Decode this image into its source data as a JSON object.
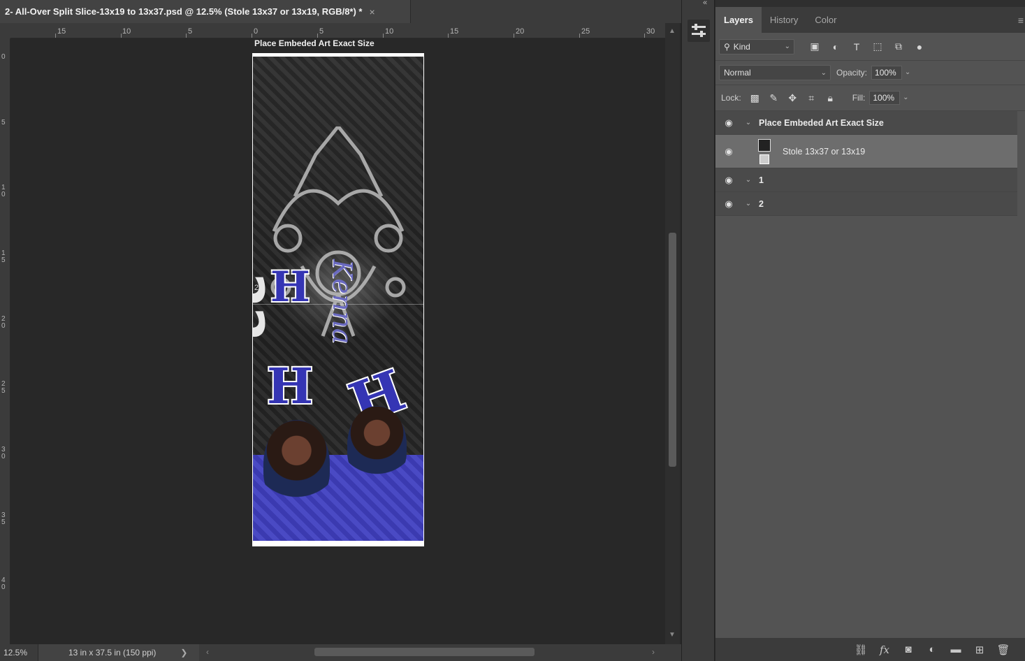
{
  "document": {
    "tab_title": "2- All-Over Split  Slice-13x19 to 13x37.psd @ 12.5% (Stole 13x37 or 13x19, RGB/8*) *",
    "close_glyph": "×"
  },
  "ruler": {
    "top_labels": [
      "15",
      "10",
      "5",
      "0",
      "5",
      "10",
      "15",
      "20",
      "25",
      "30"
    ],
    "left_labels": [
      "0",
      "5",
      "1\n0",
      "1\n5",
      "2\n0",
      "2\n5",
      "3\n0",
      "3\n5",
      "4\n0"
    ]
  },
  "canvas": {
    "caption": "Place Embeded Art Exact Size",
    "slice_marker": "2",
    "art_text_22": "22",
    "art_text_script": "Kenna"
  },
  "status": {
    "zoom": "12.5%",
    "doc_info": "13 in x 37.5 in (150 ppi)",
    "doc_info_arrow": "❯"
  },
  "panel": {
    "tabs": [
      {
        "label": "Layers",
        "active": true
      },
      {
        "label": "History",
        "active": false
      },
      {
        "label": "Color",
        "active": false
      }
    ],
    "filter_kind": "Kind",
    "blend_mode": "Normal",
    "opacity_label": "Opacity:",
    "opacity_value": "100%",
    "lock_label": "Lock:",
    "fill_label": "Fill:",
    "fill_value": "100%",
    "layers": [
      {
        "name": "Place Embeded Art Exact Size",
        "type": "group",
        "visible": true
      },
      {
        "name": "Stole 13x37 or 13x19",
        "type": "smart-object",
        "visible": true,
        "selected": true
      },
      {
        "name": "1",
        "type": "group",
        "visible": true
      },
      {
        "name": "2",
        "type": "group",
        "visible": true
      }
    ]
  },
  "colors": {
    "accent_blue": "#3535b4",
    "panel_bg": "#535353",
    "selected_layer": "#6d6d6d"
  }
}
